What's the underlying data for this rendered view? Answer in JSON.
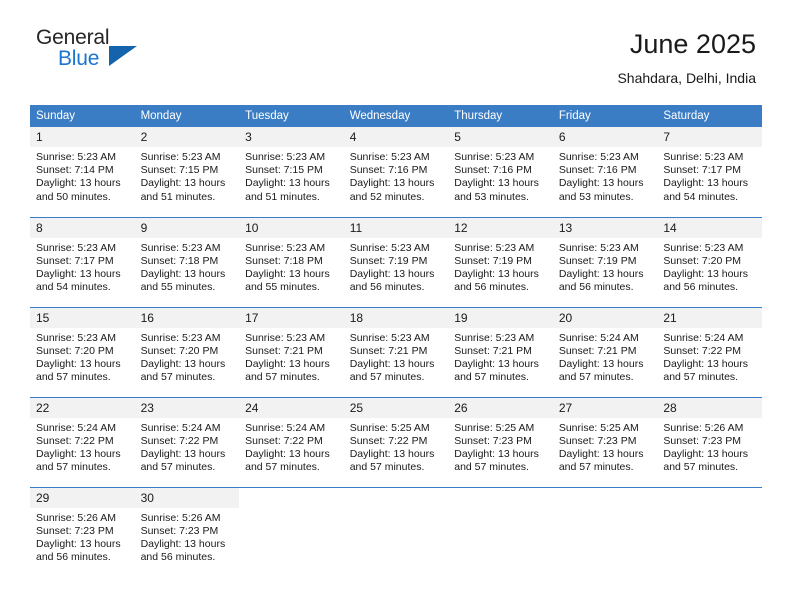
{
  "brand": {
    "word_top": "General",
    "word_bottom": "Blue",
    "triangle_icon": "brand-triangle-icon"
  },
  "header": {
    "title": "June 2025",
    "subtitle": "Shahdara, Delhi, India"
  },
  "colors": {
    "header_blue": "#3b7dc4",
    "brand_blue": "#1a75cf",
    "daynum_bg": "#f2f2f2",
    "text": "#1a1a1a"
  },
  "weekday_headers": [
    "Sunday",
    "Monday",
    "Tuesday",
    "Wednesday",
    "Thursday",
    "Friday",
    "Saturday"
  ],
  "weeks": [
    [
      {
        "day": "1",
        "sunrise": "Sunrise: 5:23 AM",
        "sunset": "Sunset: 7:14 PM",
        "daylight1": "Daylight: 13 hours",
        "daylight2": "and 50 minutes."
      },
      {
        "day": "2",
        "sunrise": "Sunrise: 5:23 AM",
        "sunset": "Sunset: 7:15 PM",
        "daylight1": "Daylight: 13 hours",
        "daylight2": "and 51 minutes."
      },
      {
        "day": "3",
        "sunrise": "Sunrise: 5:23 AM",
        "sunset": "Sunset: 7:15 PM",
        "daylight1": "Daylight: 13 hours",
        "daylight2": "and 51 minutes."
      },
      {
        "day": "4",
        "sunrise": "Sunrise: 5:23 AM",
        "sunset": "Sunset: 7:16 PM",
        "daylight1": "Daylight: 13 hours",
        "daylight2": "and 52 minutes."
      },
      {
        "day": "5",
        "sunrise": "Sunrise: 5:23 AM",
        "sunset": "Sunset: 7:16 PM",
        "daylight1": "Daylight: 13 hours",
        "daylight2": "and 53 minutes."
      },
      {
        "day": "6",
        "sunrise": "Sunrise: 5:23 AM",
        "sunset": "Sunset: 7:16 PM",
        "daylight1": "Daylight: 13 hours",
        "daylight2": "and 53 minutes."
      },
      {
        "day": "7",
        "sunrise": "Sunrise: 5:23 AM",
        "sunset": "Sunset: 7:17 PM",
        "daylight1": "Daylight: 13 hours",
        "daylight2": "and 54 minutes."
      }
    ],
    [
      {
        "day": "8",
        "sunrise": "Sunrise: 5:23 AM",
        "sunset": "Sunset: 7:17 PM",
        "daylight1": "Daylight: 13 hours",
        "daylight2": "and 54 minutes."
      },
      {
        "day": "9",
        "sunrise": "Sunrise: 5:23 AM",
        "sunset": "Sunset: 7:18 PM",
        "daylight1": "Daylight: 13 hours",
        "daylight2": "and 55 minutes."
      },
      {
        "day": "10",
        "sunrise": "Sunrise: 5:23 AM",
        "sunset": "Sunset: 7:18 PM",
        "daylight1": "Daylight: 13 hours",
        "daylight2": "and 55 minutes."
      },
      {
        "day": "11",
        "sunrise": "Sunrise: 5:23 AM",
        "sunset": "Sunset: 7:19 PM",
        "daylight1": "Daylight: 13 hours",
        "daylight2": "and 56 minutes."
      },
      {
        "day": "12",
        "sunrise": "Sunrise: 5:23 AM",
        "sunset": "Sunset: 7:19 PM",
        "daylight1": "Daylight: 13 hours",
        "daylight2": "and 56 minutes."
      },
      {
        "day": "13",
        "sunrise": "Sunrise: 5:23 AM",
        "sunset": "Sunset: 7:19 PM",
        "daylight1": "Daylight: 13 hours",
        "daylight2": "and 56 minutes."
      },
      {
        "day": "14",
        "sunrise": "Sunrise: 5:23 AM",
        "sunset": "Sunset: 7:20 PM",
        "daylight1": "Daylight: 13 hours",
        "daylight2": "and 56 minutes."
      }
    ],
    [
      {
        "day": "15",
        "sunrise": "Sunrise: 5:23 AM",
        "sunset": "Sunset: 7:20 PM",
        "daylight1": "Daylight: 13 hours",
        "daylight2": "and 57 minutes."
      },
      {
        "day": "16",
        "sunrise": "Sunrise: 5:23 AM",
        "sunset": "Sunset: 7:20 PM",
        "daylight1": "Daylight: 13 hours",
        "daylight2": "and 57 minutes."
      },
      {
        "day": "17",
        "sunrise": "Sunrise: 5:23 AM",
        "sunset": "Sunset: 7:21 PM",
        "daylight1": "Daylight: 13 hours",
        "daylight2": "and 57 minutes."
      },
      {
        "day": "18",
        "sunrise": "Sunrise: 5:23 AM",
        "sunset": "Sunset: 7:21 PM",
        "daylight1": "Daylight: 13 hours",
        "daylight2": "and 57 minutes."
      },
      {
        "day": "19",
        "sunrise": "Sunrise: 5:23 AM",
        "sunset": "Sunset: 7:21 PM",
        "daylight1": "Daylight: 13 hours",
        "daylight2": "and 57 minutes."
      },
      {
        "day": "20",
        "sunrise": "Sunrise: 5:24 AM",
        "sunset": "Sunset: 7:21 PM",
        "daylight1": "Daylight: 13 hours",
        "daylight2": "and 57 minutes."
      },
      {
        "day": "21",
        "sunrise": "Sunrise: 5:24 AM",
        "sunset": "Sunset: 7:22 PM",
        "daylight1": "Daylight: 13 hours",
        "daylight2": "and 57 minutes."
      }
    ],
    [
      {
        "day": "22",
        "sunrise": "Sunrise: 5:24 AM",
        "sunset": "Sunset: 7:22 PM",
        "daylight1": "Daylight: 13 hours",
        "daylight2": "and 57 minutes."
      },
      {
        "day": "23",
        "sunrise": "Sunrise: 5:24 AM",
        "sunset": "Sunset: 7:22 PM",
        "daylight1": "Daylight: 13 hours",
        "daylight2": "and 57 minutes."
      },
      {
        "day": "24",
        "sunrise": "Sunrise: 5:24 AM",
        "sunset": "Sunset: 7:22 PM",
        "daylight1": "Daylight: 13 hours",
        "daylight2": "and 57 minutes."
      },
      {
        "day": "25",
        "sunrise": "Sunrise: 5:25 AM",
        "sunset": "Sunset: 7:22 PM",
        "daylight1": "Daylight: 13 hours",
        "daylight2": "and 57 minutes."
      },
      {
        "day": "26",
        "sunrise": "Sunrise: 5:25 AM",
        "sunset": "Sunset: 7:23 PM",
        "daylight1": "Daylight: 13 hours",
        "daylight2": "and 57 minutes."
      },
      {
        "day": "27",
        "sunrise": "Sunrise: 5:25 AM",
        "sunset": "Sunset: 7:23 PM",
        "daylight1": "Daylight: 13 hours",
        "daylight2": "and 57 minutes."
      },
      {
        "day": "28",
        "sunrise": "Sunrise: 5:26 AM",
        "sunset": "Sunset: 7:23 PM",
        "daylight1": "Daylight: 13 hours",
        "daylight2": "and 57 minutes."
      }
    ],
    [
      {
        "day": "29",
        "sunrise": "Sunrise: 5:26 AM",
        "sunset": "Sunset: 7:23 PM",
        "daylight1": "Daylight: 13 hours",
        "daylight2": "and 56 minutes."
      },
      {
        "day": "30",
        "sunrise": "Sunrise: 5:26 AM",
        "sunset": "Sunset: 7:23 PM",
        "daylight1": "Daylight: 13 hours",
        "daylight2": "and 56 minutes."
      },
      {
        "day": "",
        "sunrise": "",
        "sunset": "",
        "daylight1": "",
        "daylight2": ""
      },
      {
        "day": "",
        "sunrise": "",
        "sunset": "",
        "daylight1": "",
        "daylight2": ""
      },
      {
        "day": "",
        "sunrise": "",
        "sunset": "",
        "daylight1": "",
        "daylight2": ""
      },
      {
        "day": "",
        "sunrise": "",
        "sunset": "",
        "daylight1": "",
        "daylight2": ""
      },
      {
        "day": "",
        "sunrise": "",
        "sunset": "",
        "daylight1": "",
        "daylight2": ""
      }
    ]
  ]
}
